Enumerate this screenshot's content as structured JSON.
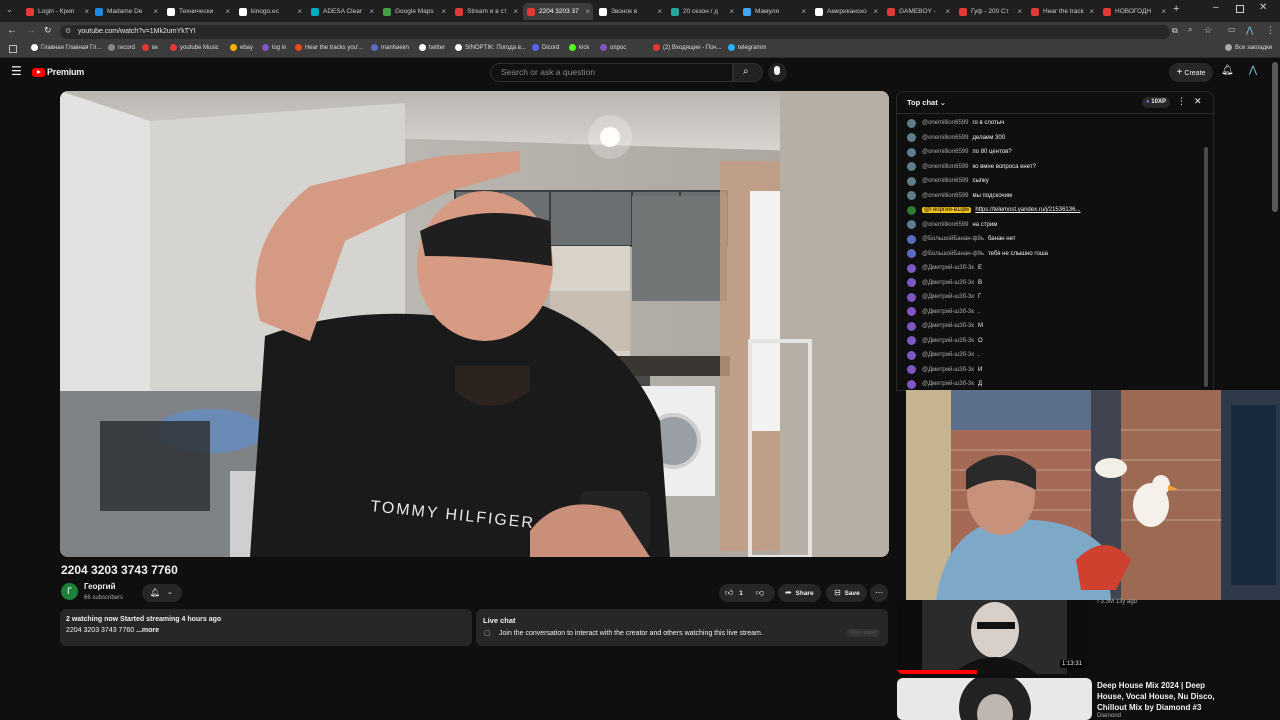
{
  "tabs": [
    {
      "label": "Login - Крип",
      "color": "#e53935"
    },
    {
      "label": "Madame De",
      "color": "#1e88e5"
    },
    {
      "label": "Технически",
      "color": "#ffffff"
    },
    {
      "label": "kinogo.ec",
      "color": "#ffffff"
    },
    {
      "label": "ADESA Clear",
      "color": "#00acc1"
    },
    {
      "label": "Google Maps",
      "color": "#43a047"
    },
    {
      "label": "Stream и в ст",
      "color": "#e53935"
    },
    {
      "label": "2204 3203 37",
      "color": "#e53935"
    },
    {
      "label": "Звонок в",
      "color": "#ffffff"
    },
    {
      "label": "20 сезон / д",
      "color": "#26a69a"
    },
    {
      "label": "Мамуля",
      "color": "#42a5f5"
    },
    {
      "label": "Американско",
      "color": "#ffffff"
    },
    {
      "label": "GAMEBOY - ",
      "color": "#e53935"
    },
    {
      "label": "Гуф - 200 Ст",
      "color": "#e53935"
    },
    {
      "label": "Hear the track",
      "color": "#e53935"
    },
    {
      "label": "НОВОГОДН",
      "color": "#e53935"
    }
  ],
  "address": {
    "url": "youtube.com/watch?v=1Mk2umYkTYI"
  },
  "bookmarks": [
    {
      "label": "Главная Главная Гл...",
      "color": "#ffffff"
    },
    {
      "label": "record",
      "color": "#888888"
    },
    {
      "label": "вк",
      "color": "#e53935"
    },
    {
      "label": "youtube Music",
      "color": "#e53935"
    },
    {
      "label": "ebay",
      "color": "#ffb300"
    },
    {
      "label": "log in",
      "color": "#7e57c2"
    },
    {
      "label": "Hear the tracks you'...",
      "color": "#e64a19"
    },
    {
      "label": "manhaeim",
      "color": "#5c6bc0"
    },
    {
      "label": "twitter",
      "color": "#ffffff"
    },
    {
      "label": "SINOPTIK: Погода в...",
      "color": "#ffffff"
    },
    {
      "label": "Dicord",
      "color": "#5865f2"
    },
    {
      "label": "kick",
      "color": "#53fc18"
    },
    {
      "label": "опрос",
      "color": "#7e57c2"
    },
    {
      "label": "(2) Входящие - Поч...",
      "color": "#e53935"
    },
    {
      "label": "telegramm",
      "color": "#29b6f6"
    },
    {
      "label": "Все закладки",
      "color": "#aaaaaa"
    }
  ],
  "yt": {
    "logo_label": "Premium",
    "search_placeholder": "Search or ask a question",
    "create_label": "Create"
  },
  "video": {
    "title": "2204 3203 3743 7760",
    "channel": "Георгий",
    "channel_initial": "Г",
    "subscribers": "66 subscribers",
    "likes": "1",
    "share_label": "Share",
    "save_label": "Save",
    "stats": "2 watching now  Started streaming 4 hours ago",
    "desc_line": "2204 3203 3743 7760",
    "more_label": "...more",
    "live_chat_title": "Live chat",
    "live_chat_text": "Join the conversation to interact with the creator and others watching this live stream.",
    "open_panel": "Open panel"
  },
  "chat": {
    "header": "Top chat",
    "points": "10XP",
    "messages": [
      {
        "author": "@onemillion6599",
        "text": "го в слотыч",
        "color": "#607d8b"
      },
      {
        "author": "@onemillion6599",
        "text": "делаем 300",
        "color": "#607d8b"
      },
      {
        "author": "@onemillion6599",
        "text": "по 80 центов?",
        "color": "#607d8b"
      },
      {
        "author": "@onemillion6599",
        "text": "ко вмне вопроса енет?",
        "color": "#607d8b"
      },
      {
        "author": "@onemillion6599",
        "text": "сыпку",
        "color": "#607d8b"
      },
      {
        "author": "@onemillion6599",
        "text": "мы подскочим",
        "color": "#607d8b"
      },
      {
        "author": "@Георгий-в1qlw",
        "text": "https://telemost.yandex.ru/j/21536136...",
        "color": "#2e7d32"
      },
      {
        "author": "@onemillion6599",
        "text": "на стрим",
        "color": "#607d8b"
      },
      {
        "author": "@БольшойБанан-ф9ь",
        "text": "банан нет",
        "color": "#5c6bc0"
      },
      {
        "author": "@БольшойБанан-ф9ь",
        "text": "тебя не слышно гоша",
        "color": "#5c6bc0"
      },
      {
        "author": "@Дмитрий-ш3б-3к",
        "text": "Е",
        "color": "#7e57c2"
      },
      {
        "author": "@Дмитрий-ш3б-3к",
        "text": "В",
        "color": "#7e57c2"
      },
      {
        "author": "@Дмитрий-ш3б-3к",
        "text": "Г",
        "color": "#7e57c2"
      },
      {
        "author": "@Дмитрий-ш3б-3к",
        "text": ".",
        "color": "#7e57c2"
      },
      {
        "author": "@Дмитрий-ш3б-3к",
        "text": "М",
        "color": "#7e57c2"
      },
      {
        "author": "@Дмитрий-ш3б-3к",
        "text": "О",
        "color": "#7e57c2"
      },
      {
        "author": "@Дмитрий-ш3б-3к",
        "text": ".",
        "color": "#7e57c2"
      },
      {
        "author": "@Дмитрий-ш3б-3к",
        "text": "И",
        "color": "#7e57c2"
      },
      {
        "author": "@Дмитрий-ш3б-3к",
        "text": "Д",
        "color": "#7e57c2"
      }
    ]
  },
  "recs": [
    {
      "meta": "› 3.3M  13y ago",
      "duration": "1:13:31"
    },
    {
      "title": "Deep House Mix 2024 | Deep House, Vocal House, Nu Disco, Chillout Mix by Diamond #3",
      "channel": "Diamond"
    }
  ]
}
